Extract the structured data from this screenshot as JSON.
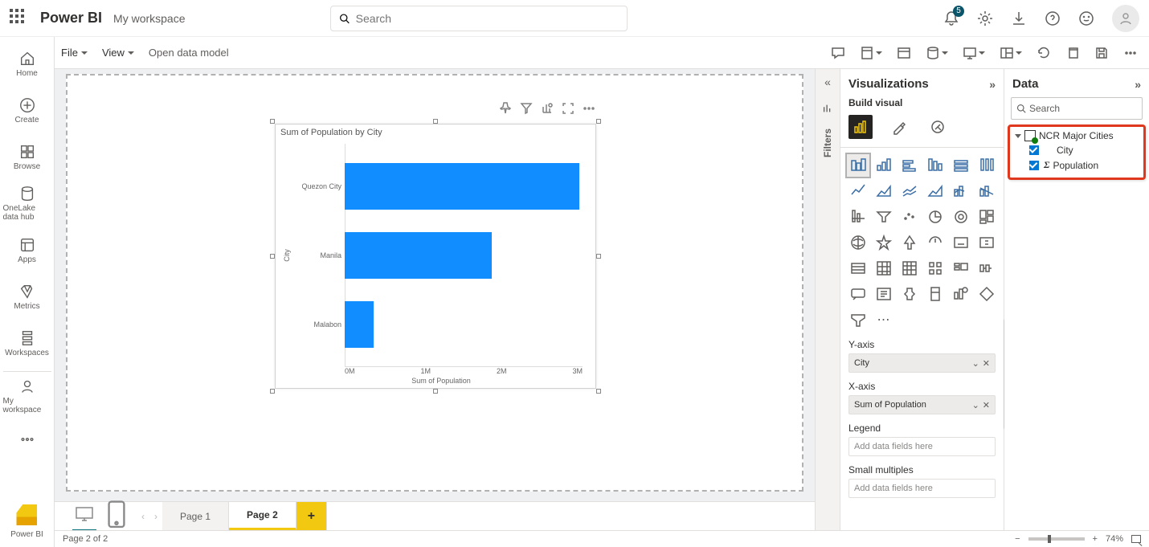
{
  "app": {
    "brand": "Power BI",
    "workspace": "My workspace"
  },
  "search": {
    "placeholder": "Search"
  },
  "notifications": {
    "count": "5"
  },
  "toolbar": {
    "file": "File",
    "view": "View",
    "open_model": "Open data model"
  },
  "leftrail": {
    "home": "Home",
    "create": "Create",
    "browse": "Browse",
    "onelake": "OneLake data hub",
    "apps": "Apps",
    "metrics": "Metrics",
    "workspaces": "Workspaces",
    "myworkspace": "My workspace",
    "powerbi": "Power BI"
  },
  "filters": {
    "label": "Filters"
  },
  "vizpane": {
    "title": "Visualizations",
    "subtitle": "Build visual",
    "sections": {
      "y": "Y-axis",
      "x": "X-axis",
      "legend": "Legend",
      "small": "Small multiples"
    },
    "wells": {
      "y": "City",
      "x": "Sum of Population",
      "placeholder": "Add data fields here"
    }
  },
  "datapane": {
    "title": "Data",
    "search_placeholder": "Search",
    "table": "NCR Major Cities",
    "fields": {
      "city": "City",
      "population": "Population"
    }
  },
  "pages": {
    "p1": "Page 1",
    "p2": "Page 2",
    "status": "Page 2 of 2"
  },
  "zoom": {
    "pct": "74%"
  },
  "chart": {
    "title": "Sum of Population by City",
    "ylabel": "City",
    "xlabel": "Sum of Population"
  },
  "chart_data": {
    "type": "bar",
    "orientation": "horizontal",
    "title": "Sum of Population by City",
    "xlabel": "Sum of Population",
    "ylabel": "City",
    "xlim": [
      0,
      3000000
    ],
    "xticks": [
      "0M",
      "1M",
      "2M",
      "3M"
    ],
    "categories": [
      "Quezon City",
      "Manila",
      "Malabon"
    ],
    "values": [
      2960000,
      1850000,
      365000
    ]
  }
}
